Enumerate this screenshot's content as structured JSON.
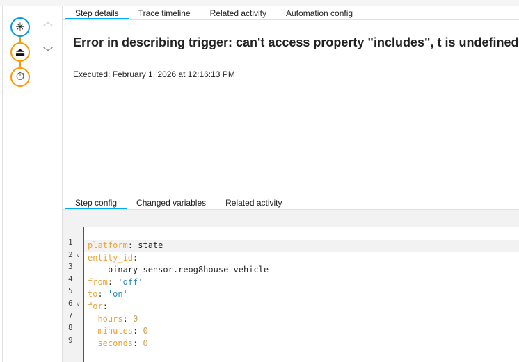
{
  "timeline": {
    "nodes": [
      {
        "icon": "asterisk-icon",
        "glyph": "✳",
        "color": "#039be5"
      },
      {
        "icon": "bell-icon",
        "glyph": "⏏",
        "color": "#ff9800"
      },
      {
        "icon": "timer-icon",
        "glyph": "⏱",
        "color": "#ff9800"
      }
    ]
  },
  "tabs": [
    "Step details",
    "Trace timeline",
    "Related activity",
    "Automation config"
  ],
  "title": "Error in describing trigger: can't access property \"includes\", t is undefined",
  "executed": "Executed: February 1, 2026 at 12:16:13 PM",
  "subtabs": [
    "Step config",
    "Changed variables",
    "Related activity"
  ],
  "code": {
    "line_numbers": [
      "1",
      "2",
      "3",
      "4",
      "5",
      "6",
      "7",
      "8",
      "9"
    ],
    "lines": [
      {
        "key": "platform",
        "sep": ": ",
        "val": "state",
        "type": "v"
      },
      {
        "key": "entity_id",
        "sep": ":",
        "val": "",
        "type": "v"
      },
      {
        "key": "",
        "sep": "  - ",
        "val": "binary_sensor.reog8house_vehicle",
        "type": "v"
      },
      {
        "key": "from",
        "sep": ": ",
        "val": "'off'",
        "type": "s"
      },
      {
        "key": "to",
        "sep": ": ",
        "val": "'on'",
        "type": "s"
      },
      {
        "key": "for",
        "sep": ":",
        "val": "",
        "type": "v"
      },
      {
        "key": "  hours",
        "sep": ": ",
        "val": "0",
        "type": "n"
      },
      {
        "key": "  minutes",
        "sep": ": ",
        "val": "0",
        "type": "n"
      },
      {
        "key": "  seconds",
        "sep": ": ",
        "val": "0",
        "type": "n"
      }
    ]
  }
}
